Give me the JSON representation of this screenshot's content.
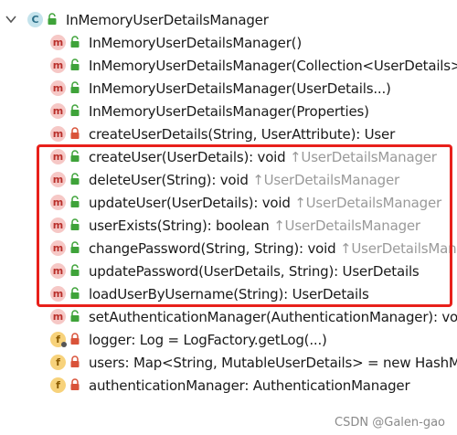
{
  "tree": {
    "root": {
      "icon": "class-icon",
      "icon_glyph": "C",
      "label": "InMemoryUserDetailsManager"
    },
    "members": [
      {
        "kind": "method",
        "glyph": "m",
        "access": "public",
        "label": "InMemoryUserDetailsManager()",
        "inherited": ""
      },
      {
        "kind": "method",
        "glyph": "m",
        "access": "public",
        "label": "InMemoryUserDetailsManager(Collection<UserDetails>)",
        "inherited": ""
      },
      {
        "kind": "method",
        "glyph": "m",
        "access": "public",
        "label": "InMemoryUserDetailsManager(UserDetails...)",
        "inherited": ""
      },
      {
        "kind": "method",
        "glyph": "m",
        "access": "public",
        "label": "InMemoryUserDetailsManager(Properties)",
        "inherited": ""
      },
      {
        "kind": "method",
        "glyph": "m",
        "access": "private",
        "label": "createUserDetails(String, UserAttribute): User",
        "inherited": ""
      },
      {
        "kind": "method",
        "glyph": "m",
        "access": "public",
        "label": "createUser(UserDetails): void ",
        "inherited": "↑UserDetailsManager"
      },
      {
        "kind": "method",
        "glyph": "m",
        "access": "public",
        "label": "deleteUser(String): void ",
        "inherited": "↑UserDetailsManager"
      },
      {
        "kind": "method",
        "glyph": "m",
        "access": "public",
        "label": "updateUser(UserDetails): void ",
        "inherited": "↑UserDetailsManager"
      },
      {
        "kind": "method",
        "glyph": "m",
        "access": "public",
        "label": "userExists(String): boolean ",
        "inherited": "↑UserDetailsManager"
      },
      {
        "kind": "method",
        "glyph": "m",
        "access": "public",
        "label": "changePassword(String, String): void ",
        "inherited": "↑UserDetailsManager"
      },
      {
        "kind": "method",
        "glyph": "m",
        "access": "public",
        "label": "updatePassword(UserDetails, String): UserDetails",
        "inherited": ""
      },
      {
        "kind": "method",
        "glyph": "m",
        "access": "public",
        "label": "loadUserByUsername(String): UserDetails",
        "inherited": ""
      },
      {
        "kind": "method",
        "glyph": "m",
        "access": "public",
        "label": "setAuthenticationManager(AuthenticationManager): void",
        "inherited": ""
      },
      {
        "kind": "field",
        "glyph": "f",
        "access": "static-private",
        "label": "logger: Log = LogFactory.getLog(...)",
        "inherited": ""
      },
      {
        "kind": "field",
        "glyph": "f",
        "access": "private",
        "label": "users: Map<String, MutableUserDetails> = new HashMap<>()",
        "inherited": ""
      },
      {
        "kind": "field",
        "glyph": "f",
        "access": "private",
        "label": "authenticationManager: AuthenticationManager",
        "inherited": ""
      }
    ]
  },
  "watermark": "CSDN @Galen-gao",
  "colors": {
    "highlight": "#e8201b",
    "method_icon_bg": "#f6c8c6",
    "field_icon_bg": "#f7d27b",
    "class_icon_bg": "#c4e3ec",
    "public_access": "#3fa33a",
    "private_access": "#d9533a",
    "inherited_text": "#9a9a9a"
  }
}
